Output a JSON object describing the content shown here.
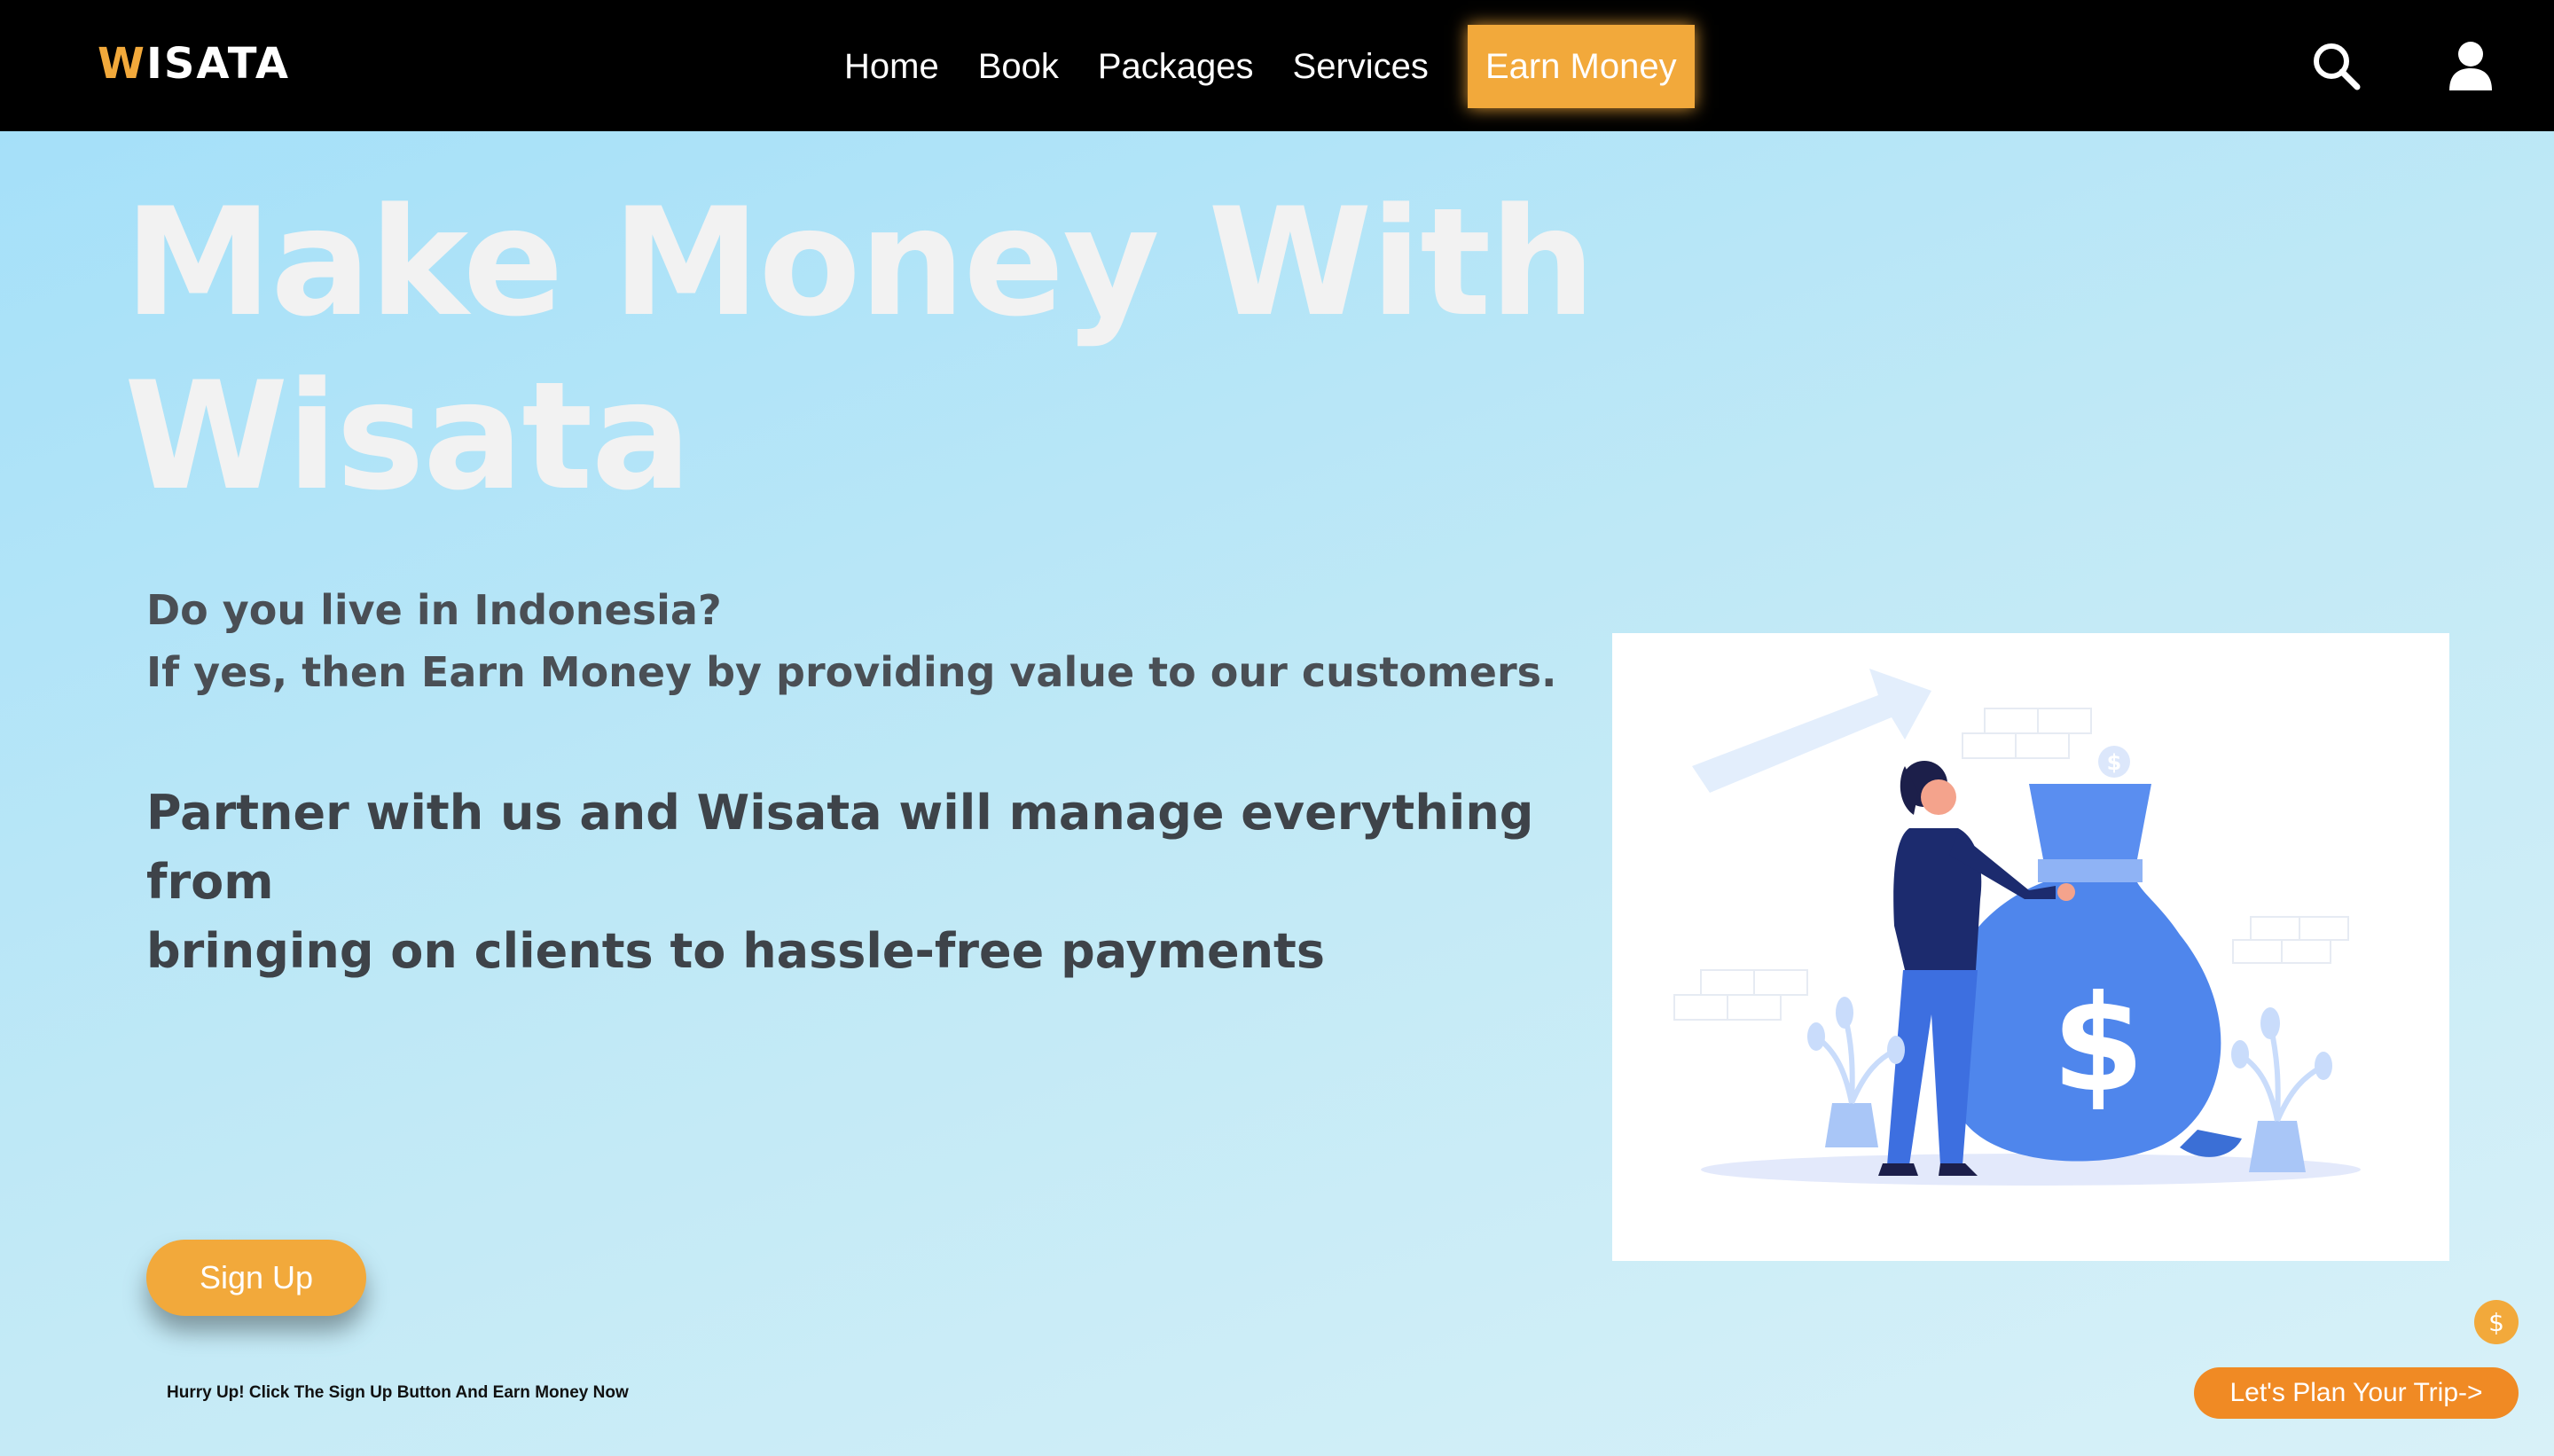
{
  "brand": {
    "first_letter": "W",
    "rest": "ISATA"
  },
  "nav": {
    "items": [
      {
        "label": "Home"
      },
      {
        "label": "Book"
      },
      {
        "label": "Packages"
      },
      {
        "label": "Services"
      },
      {
        "label": "Earn Money",
        "active": true
      }
    ],
    "icons": [
      "search-icon",
      "user-icon"
    ]
  },
  "hero": {
    "headline_line1": "Make Money With",
    "headline_line2": "Wisata",
    "intro_line1": "Do you live in Indonesia?",
    "intro_line2": "If yes, then Earn Money by providing value to our customers.",
    "partner_line1": "Partner with us and Wisata will manage everything from",
    "partner_line2": "bringing on clients to hassle-free payments",
    "signup_label": "Sign Up",
    "hurry_text": "Hurry Up! Click The Sign Up Button And Earn Money Now",
    "plan_label": "Let's Plan Your Trip->",
    "coin_symbol": "$",
    "illustration_symbol": "$"
  },
  "colors": {
    "accent": "#f2a93b",
    "nav_bg": "#000000",
    "plan_button": "#f08a24",
    "money_bag": "#4f86ec"
  }
}
